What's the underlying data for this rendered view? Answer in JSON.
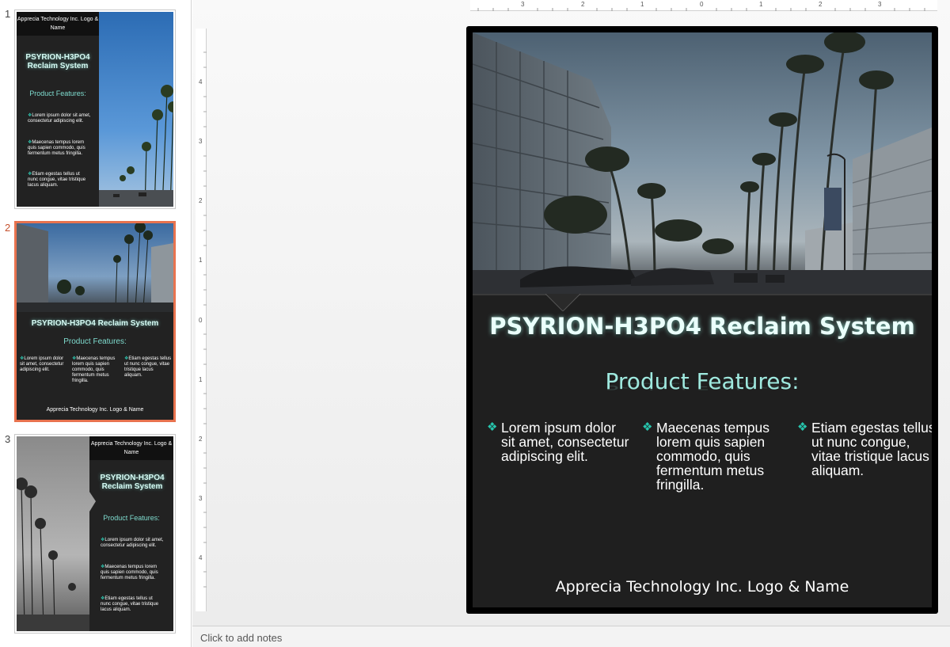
{
  "thumbnails": [
    {
      "number": "1",
      "logo": "Apprecia Technology Inc. Logo & Name",
      "title": "PSYRION-H3PO4 Reclaim System",
      "subtitle": "Product Features:",
      "bullets": [
        "Lorem ipsum dolor sit amet, consectetur adipiscing elit.",
        "Maecenas tempus lorem quis sapien commodo, quis fermentum metus fringilla.",
        "Etiam egestas tellus ut nunc congue, vitae tristique lacus aliquam."
      ]
    },
    {
      "number": "2",
      "title": "PSYRION-H3PO4 Reclaim System",
      "subtitle": "Product Features:",
      "bullets": [
        "Lorem ipsum dolor sit amet, consectetur adipiscing elit.",
        "Maecenas tempus lorem quis sapien commodo, quis fermentum metus fringilla.",
        "Etiam egestas tellus ut nunc congue, vitae tristique lacus aliquam."
      ],
      "footer": "Apprecia Technology Inc. Logo & Name"
    },
    {
      "number": "3",
      "logo": "Apprecia Technology Inc. Logo & Name",
      "title": "PSYRION-H3PO4 Reclaim System",
      "subtitle": "Product Features:",
      "bullets": [
        "Lorem ipsum dolor sit amet, consectetur adipiscing elit.",
        "Maecenas tempus lorem quis sapien commodo, quis fermentum metus fringilla.",
        "Etiam egestas tellus ut nunc congue, vitae tristique lacus aliquam."
      ]
    }
  ],
  "slide": {
    "title": "PSYRION-H3PO4 Reclaim System",
    "subtitle": "Product Features:",
    "bullets": [
      "Lorem ipsum dolor sit amet, consectetur adipiscing elit.",
      "Maecenas tempus lorem quis sapien commodo, quis fermentum metus fringilla.",
      "Etiam egestas tellus ut nunc congue, vitae tristique lacus aliquam."
    ],
    "footer": "Apprecia Technology Inc. Logo & Name",
    "bullet_glyph": "❖"
  },
  "rulers": {
    "horizontal": [
      "3",
      "2",
      "1",
      "0",
      "1",
      "2",
      "3"
    ],
    "vertical": [
      "4",
      "3",
      "2",
      "1",
      "0",
      "1",
      "2",
      "3",
      "4"
    ]
  },
  "notes": {
    "placeholder": "Click to add notes"
  },
  "colors": {
    "accent": "#e8734f",
    "title_glow": "#d6fbf4",
    "bullet_diamond": "#27c5ad",
    "slide_bg": "#1f1f1f"
  }
}
